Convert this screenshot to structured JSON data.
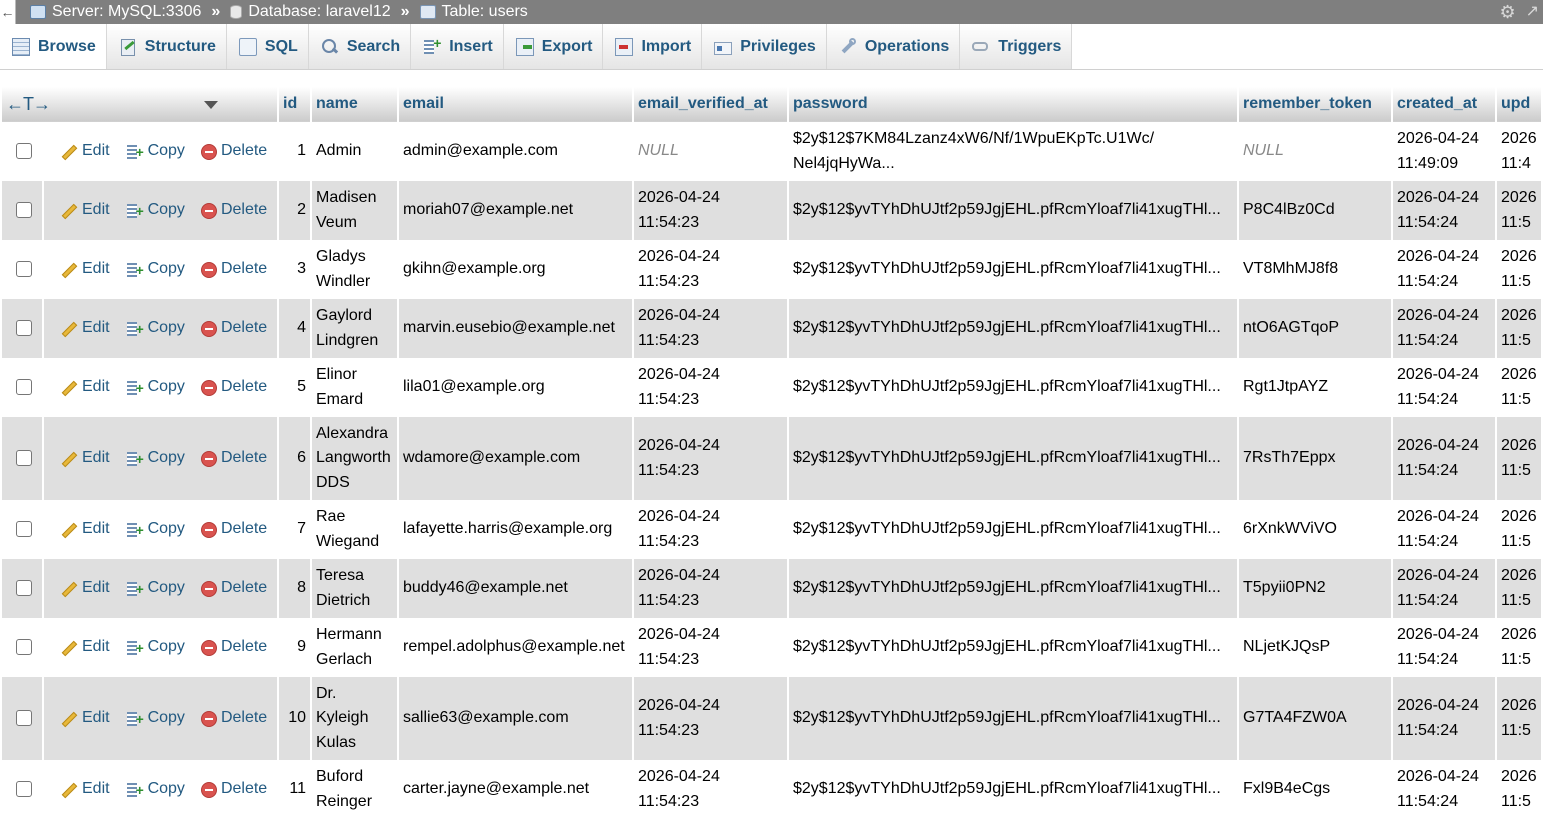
{
  "breadcrumb": {
    "server": "Server: MySQL:3306",
    "database": "Database: laravel12",
    "table": "Table: users",
    "separator": "»"
  },
  "tabs": [
    {
      "label": "Browse",
      "icon": "browse-icon",
      "active": true
    },
    {
      "label": "Structure",
      "icon": "structure-icon"
    },
    {
      "label": "SQL",
      "icon": "sql-icon"
    },
    {
      "label": "Search",
      "icon": "search-icon"
    },
    {
      "label": "Insert",
      "icon": "insert-icon"
    },
    {
      "label": "Export",
      "icon": "export-icon"
    },
    {
      "label": "Import",
      "icon": "import-icon"
    },
    {
      "label": "Privileges",
      "icon": "privileges-icon"
    },
    {
      "label": "Operations",
      "icon": "operations-icon"
    },
    {
      "label": "Triggers",
      "icon": "triggers-icon"
    }
  ],
  "table": {
    "control_glyph": "←T→",
    "headers": {
      "id": "id",
      "name": "name",
      "email": "email",
      "email_verified_at": "email_verified_at",
      "password": "password",
      "remember_token": "remember_token",
      "created_at": "created_at",
      "updated_at": "upd"
    },
    "actions": {
      "edit": "Edit",
      "copy": "Copy",
      "delete": "Delete"
    },
    "rows": [
      {
        "id": "1",
        "name": [
          "Admin"
        ],
        "email": "admin@example.com",
        "verified": [
          "NULL"
        ],
        "verified_null": true,
        "password": [
          "$2y$12$7KM84Lzanz4xW6/Nf/1WpuEKpTc.U1Wc/",
          "Nel4jqHyWa..."
        ],
        "token": "NULL",
        "token_null": true,
        "created": [
          "2026-04-24",
          "11:49:09"
        ],
        "updated": [
          "2026",
          "11:4"
        ]
      },
      {
        "id": "2",
        "name": [
          "Madisen",
          "Veum"
        ],
        "email": "moriah07@example.net",
        "verified": [
          "2026-04-24",
          "11:54:23"
        ],
        "password": [
          "$2y$12$yvTYhDhUJtf2p59JgjEHL.pfRcmYloaf7li41xugTHl..."
        ],
        "token": "P8C4lBz0Cd",
        "created": [
          "2026-04-24",
          "11:54:24"
        ],
        "updated": [
          "2026",
          "11:5"
        ]
      },
      {
        "id": "3",
        "name": [
          "Gladys",
          "Windler"
        ],
        "email": "gkihn@example.org",
        "verified": [
          "2026-04-24",
          "11:54:23"
        ],
        "password": [
          "$2y$12$yvTYhDhUJtf2p59JgjEHL.pfRcmYloaf7li41xugTHl..."
        ],
        "token": "VT8MhMJ8f8",
        "created": [
          "2026-04-24",
          "11:54:24"
        ],
        "updated": [
          "2026",
          "11:5"
        ]
      },
      {
        "id": "4",
        "name": [
          "Gaylord",
          "Lindgren"
        ],
        "email": "marvin.eusebio@example.net",
        "verified": [
          "2026-04-24",
          "11:54:23"
        ],
        "password": [
          "$2y$12$yvTYhDhUJtf2p59JgjEHL.pfRcmYloaf7li41xugTHl..."
        ],
        "token": "ntO6AGTqoP",
        "created": [
          "2026-04-24",
          "11:54:24"
        ],
        "updated": [
          "2026",
          "11:5"
        ]
      },
      {
        "id": "5",
        "name": [
          "Elinor",
          "Emard"
        ],
        "email": "lila01@example.org",
        "verified": [
          "2026-04-24",
          "11:54:23"
        ],
        "password": [
          "$2y$12$yvTYhDhUJtf2p59JgjEHL.pfRcmYloaf7li41xugTHl..."
        ],
        "token": "Rgt1JtpAYZ",
        "created": [
          "2026-04-24",
          "11:54:24"
        ],
        "updated": [
          "2026",
          "11:5"
        ]
      },
      {
        "id": "6",
        "name": [
          "Alexandra",
          "Langworth",
          "DDS"
        ],
        "email": "wdamore@example.com",
        "verified": [
          "2026-04-24",
          "11:54:23"
        ],
        "password": [
          "$2y$12$yvTYhDhUJtf2p59JgjEHL.pfRcmYloaf7li41xugTHl..."
        ],
        "token": "7RsTh7Eppx",
        "created": [
          "2026-04-24",
          "11:54:24"
        ],
        "updated": [
          "2026",
          "11:5"
        ]
      },
      {
        "id": "7",
        "name": [
          "Rae",
          "Wiegand"
        ],
        "email": "lafayette.harris@example.org",
        "verified": [
          "2026-04-24",
          "11:54:23"
        ],
        "password": [
          "$2y$12$yvTYhDhUJtf2p59JgjEHL.pfRcmYloaf7li41xugTHl..."
        ],
        "token": "6rXnkWViVO",
        "created": [
          "2026-04-24",
          "11:54:24"
        ],
        "updated": [
          "2026",
          "11:5"
        ]
      },
      {
        "id": "8",
        "name": [
          "Teresa",
          "Dietrich"
        ],
        "email": "buddy46@example.net",
        "verified": [
          "2026-04-24",
          "11:54:23"
        ],
        "password": [
          "$2y$12$yvTYhDhUJtf2p59JgjEHL.pfRcmYloaf7li41xugTHl..."
        ],
        "token": "T5pyii0PN2",
        "created": [
          "2026-04-24",
          "11:54:24"
        ],
        "updated": [
          "2026",
          "11:5"
        ]
      },
      {
        "id": "9",
        "name": [
          "Hermann",
          "Gerlach"
        ],
        "email": "rempel.adolphus@example.net",
        "verified": [
          "2026-04-24",
          "11:54:23"
        ],
        "password": [
          "$2y$12$yvTYhDhUJtf2p59JgjEHL.pfRcmYloaf7li41xugTHl..."
        ],
        "token": "NLjetKJQsP",
        "created": [
          "2026-04-24",
          "11:54:24"
        ],
        "updated": [
          "2026",
          "11:5"
        ]
      },
      {
        "id": "10",
        "name": [
          "Dr.",
          "Kyleigh",
          "Kulas"
        ],
        "email": "sallie63@example.com",
        "verified": [
          "2026-04-24",
          "11:54:23"
        ],
        "password": [
          "$2y$12$yvTYhDhUJtf2p59JgjEHL.pfRcmYloaf7li41xugTHl..."
        ],
        "token": "G7TA4FZW0A",
        "created": [
          "2026-04-24",
          "11:54:24"
        ],
        "updated": [
          "2026",
          "11:5"
        ]
      },
      {
        "id": "11",
        "name": [
          "Buford",
          "Reinger"
        ],
        "email": "carter.jayne@example.net",
        "verified": [
          "2026-04-24",
          "11:54:23"
        ],
        "password": [
          "$2y$12$yvTYhDhUJtf2p59JgjEHL.pfRcmYloaf7li41xugTHl..."
        ],
        "token": "Fxl9B4eCgs",
        "created": [
          "2026-04-24",
          "11:54:24"
        ],
        "updated": [
          "2026",
          "11:5"
        ]
      }
    ]
  }
}
